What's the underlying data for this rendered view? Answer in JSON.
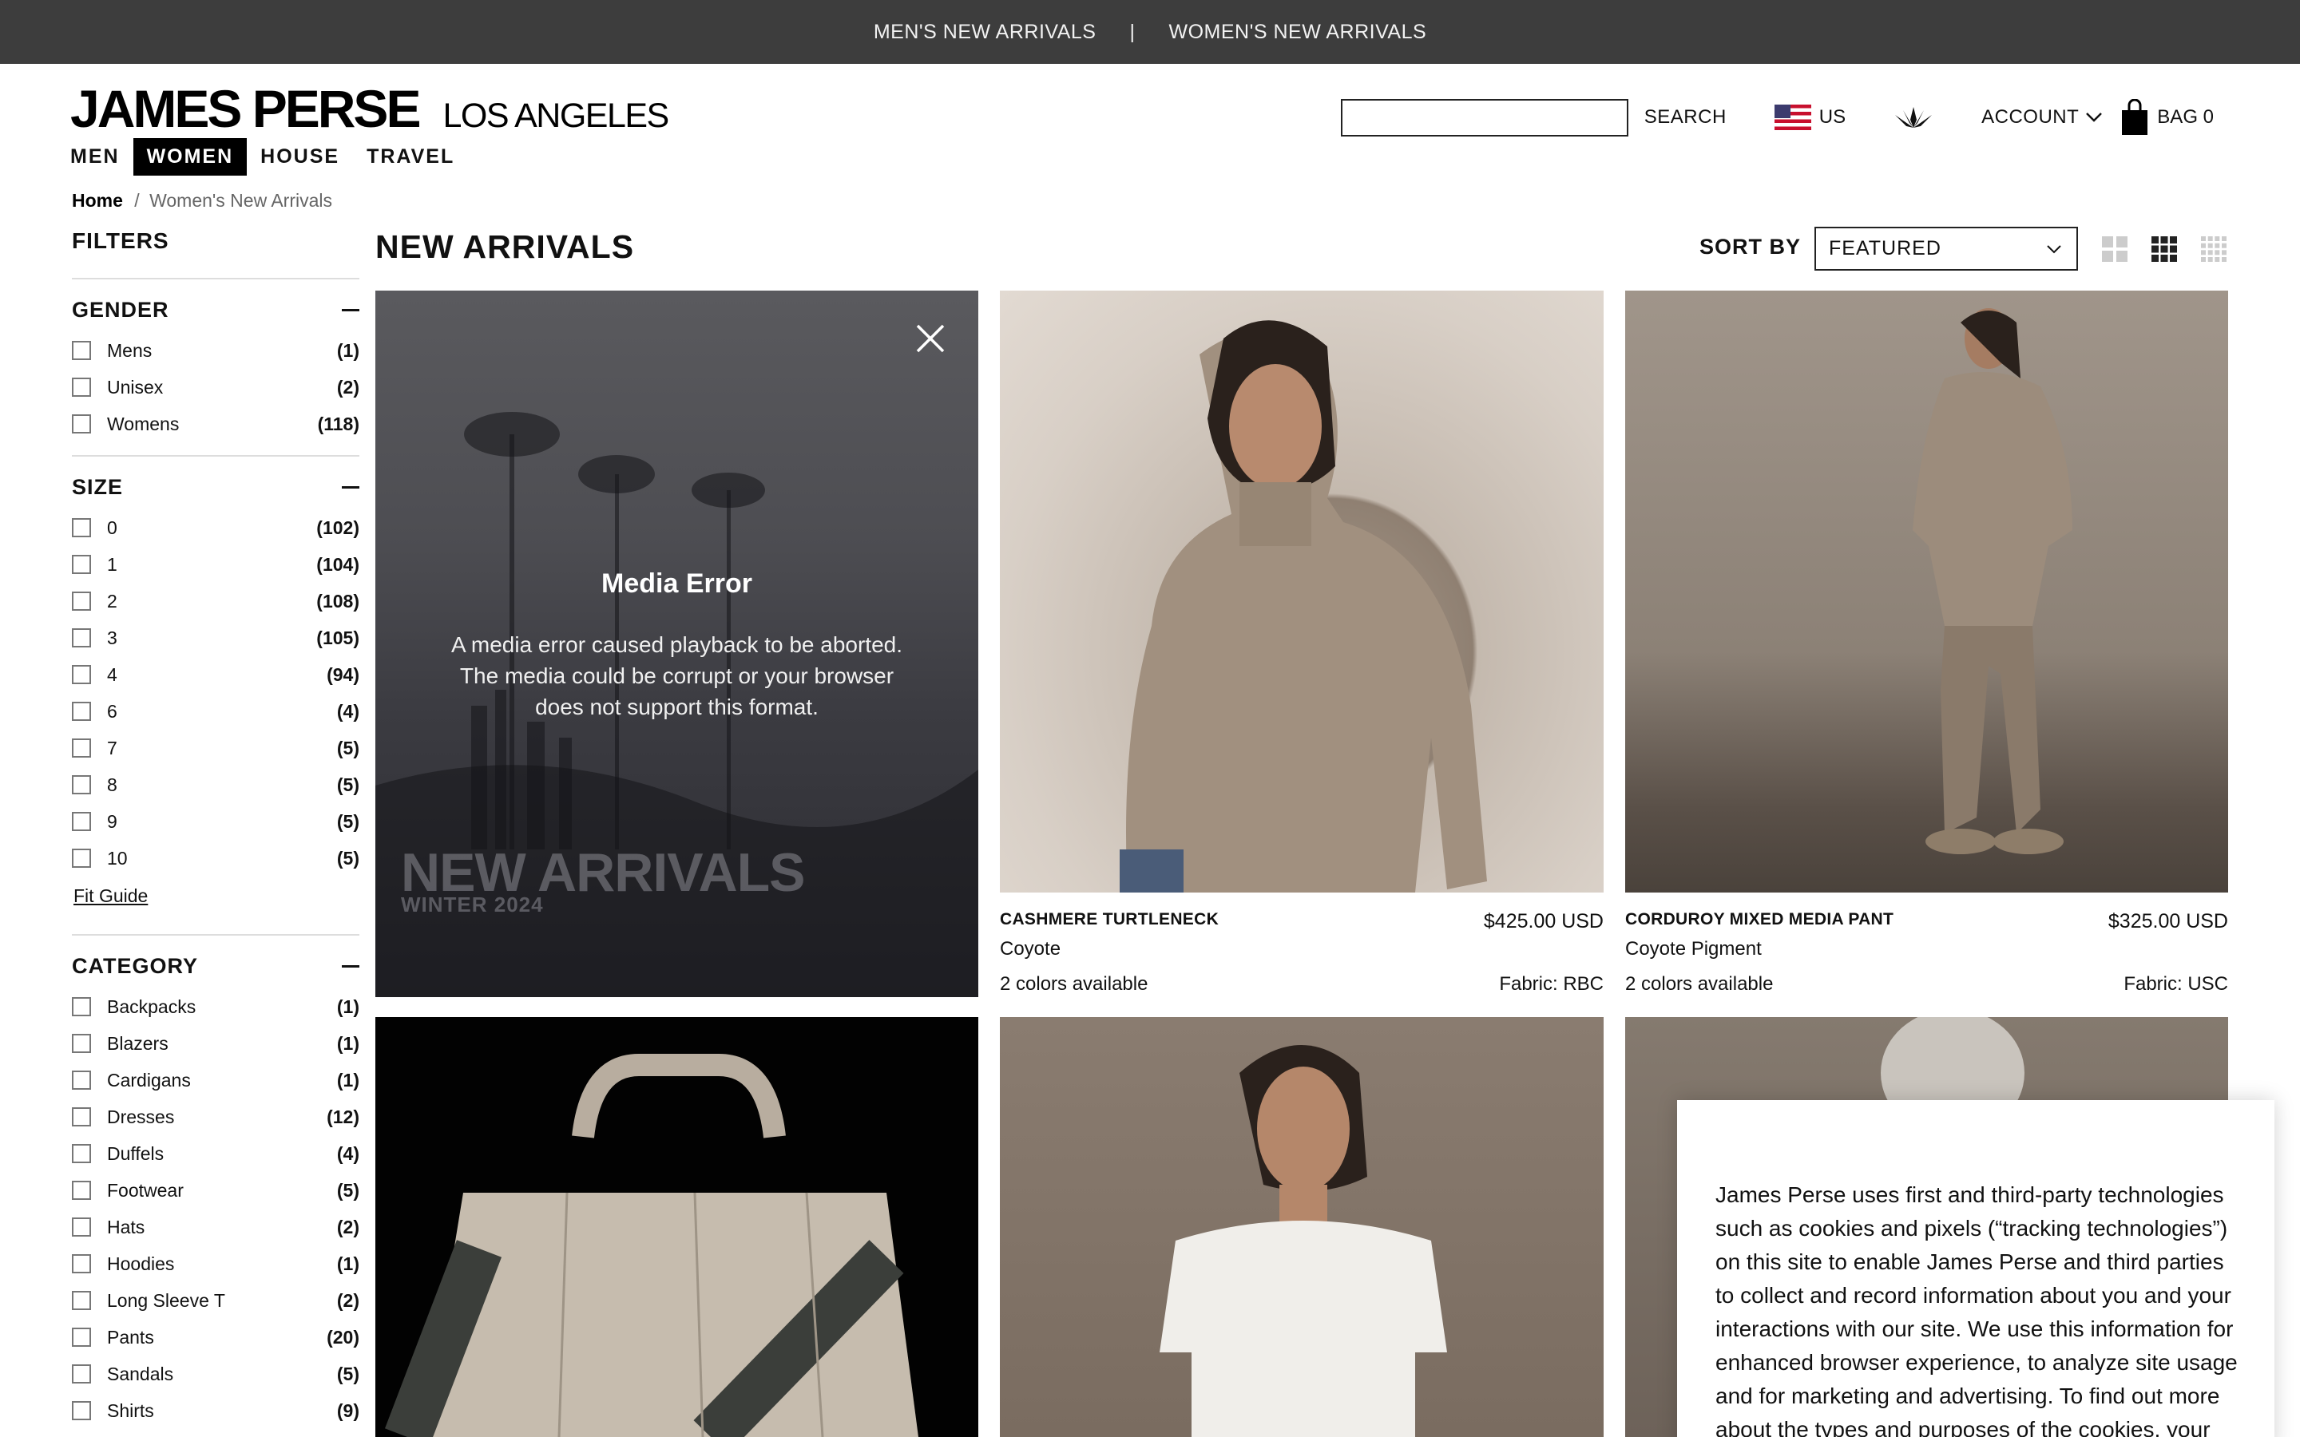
{
  "announcement": {
    "left": "MEN'S NEW ARRIVALS",
    "sep": "|",
    "right": "WOMEN'S NEW ARRIVALS"
  },
  "brand": {
    "logo": "JAMES PERSE",
    "city": "LOS ANGELES"
  },
  "nav": {
    "items": [
      "MEN",
      "WOMEN",
      "HOUSE",
      "TRAVEL"
    ],
    "active": "WOMEN"
  },
  "utility": {
    "search_label": "SEARCH",
    "search_value": "",
    "country": "US",
    "account": "ACCOUNT",
    "bag": "BAG 0"
  },
  "breadcrumb": {
    "home": "Home",
    "separator": "/",
    "current": "Women's New Arrivals"
  },
  "filters": {
    "title": "FILTERS",
    "gender": {
      "title": "GENDER",
      "options": [
        {
          "label": "Mens",
          "count": "(1)"
        },
        {
          "label": "Unisex",
          "count": "(2)"
        },
        {
          "label": "Womens",
          "count": "(118)"
        }
      ]
    },
    "size": {
      "title": "SIZE",
      "options": [
        {
          "label": "0",
          "count": "(102)"
        },
        {
          "label": "1",
          "count": "(104)"
        },
        {
          "label": "2",
          "count": "(108)"
        },
        {
          "label": "3",
          "count": "(105)"
        },
        {
          "label": "4",
          "count": "(94)"
        },
        {
          "label": "6",
          "count": "(4)"
        },
        {
          "label": "7",
          "count": "(5)"
        },
        {
          "label": "8",
          "count": "(5)"
        },
        {
          "label": "9",
          "count": "(5)"
        },
        {
          "label": "10",
          "count": "(5)"
        }
      ],
      "fit_guide": "Fit Guide"
    },
    "category": {
      "title": "CATEGORY",
      "options": [
        {
          "label": "Backpacks",
          "count": "(1)"
        },
        {
          "label": "Blazers",
          "count": "(1)"
        },
        {
          "label": "Cardigans",
          "count": "(1)"
        },
        {
          "label": "Dresses",
          "count": "(12)"
        },
        {
          "label": "Duffels",
          "count": "(4)"
        },
        {
          "label": "Footwear",
          "count": "(5)"
        },
        {
          "label": "Hats",
          "count": "(2)"
        },
        {
          "label": "Hoodies",
          "count": "(1)"
        },
        {
          "label": "Long Sleeve T",
          "count": "(2)"
        },
        {
          "label": "Pants",
          "count": "(20)"
        },
        {
          "label": "Sandals",
          "count": "(5)"
        },
        {
          "label": "Shirts",
          "count": "(9)"
        }
      ]
    }
  },
  "main": {
    "heading": "NEW ARRIVALS",
    "sort_label": "SORT BY",
    "sort_value": "FEATURED"
  },
  "media": {
    "error_title": "Media Error",
    "error_line1": "A media error caused playback to be aborted.",
    "error_line2": "The media could be corrupt or your browser",
    "error_line3": "does not support this format.",
    "promo_title": "NEW ARRIVALS",
    "promo_sub": "WINTER 2024"
  },
  "products": [
    {
      "name": "CASHMERE TURTLENECK",
      "price": "$425.00 USD",
      "color": "Coyote",
      "colors": "2 colors available",
      "fabric": "Fabric: RBC"
    },
    {
      "name": "CORDUROY MIXED MEDIA PANT",
      "price": "$325.00 USD",
      "color": "Coyote Pigment",
      "colors": "2 colors available",
      "fabric": "Fabric: USC"
    }
  ],
  "cookie": {
    "text": "James Perse uses first and third-party technologies such as cookies and pixels (“tracking technologies”) on this site to enable James Perse and third parties to collect and record information about you and your interactions with our site. We use this information for enhanced browser experience, to analyze site usage and for marketing and advertising. To find out more about the types and purposes of the cookies, your"
  },
  "colors": {
    "topbar": "#3d3d3d",
    "accent": "#000000"
  }
}
